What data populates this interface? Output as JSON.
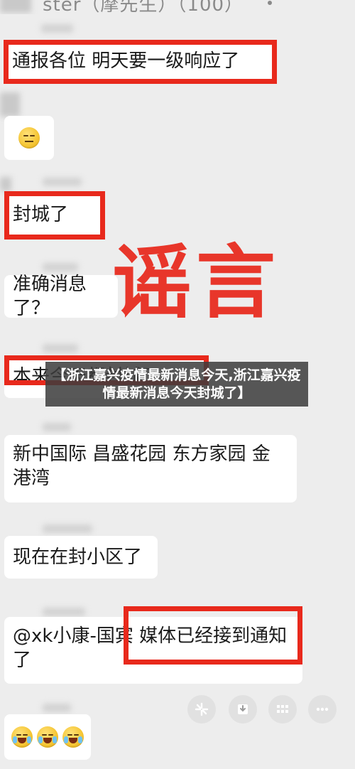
{
  "chat": {
    "title": "ster（摩先生）（100）",
    "more_icon": "more-icon",
    "messages": [
      "通报各位 明天要一级响应了",
      "封城了",
      "准确消息了？",
      "本来今天都封城了",
      "新中国际 昌盛花园 东方家园 金港湾",
      "现在在封小区了",
      "@xk小康-国宾 媒体已经接到通知了"
    ],
    "emojis": [
      "sleepy-face-emoji",
      "crying-laughing-emoji",
      "crying-laughing-emoji",
      "crying-laughing-emoji"
    ]
  },
  "stamp": {
    "text": "谣言",
    "color": "#e8291c"
  },
  "caption": {
    "text": "【浙江嘉兴疫情最新消息今天,浙江嘉兴疫情最新消息今天封城了】"
  },
  "toolbar": {
    "icons": [
      "sparkle-icon",
      "download-icon",
      "grid-icon",
      "more-icon"
    ]
  },
  "colors": {
    "highlight": "#e8291c",
    "chat_background": "#ededed",
    "bubble": "#ffffff"
  }
}
